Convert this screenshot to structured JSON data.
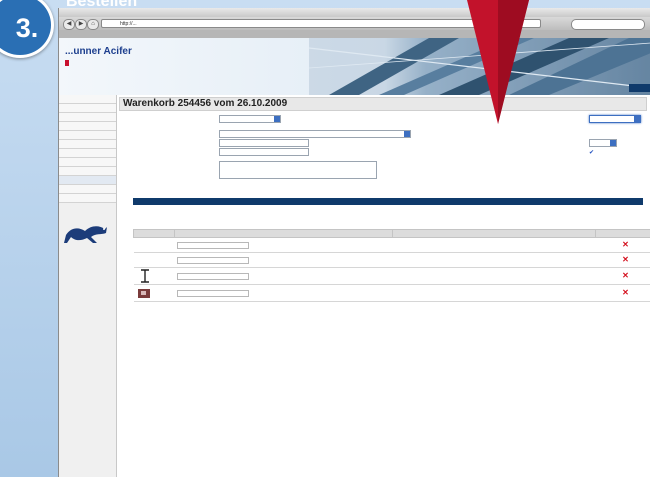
{
  "step": {
    "number": "3.",
    "title": "Bestellen"
  },
  "colors": {
    "brand_blue": "#2a6fb4",
    "nav_navy": "#0f3a6b",
    "accent_red": "#c8102e",
    "arrow_red": "#c2122b"
  },
  "browser": {
    "url": "http://..."
  },
  "site": {
    "logo_text": "...unner Acifer",
    "topnav": [
      "",
      "",
      "",
      "",
      ""
    ]
  },
  "sidebar": {
    "items": [
      "",
      "",
      "",
      "",
      "",
      "",
      "",
      "",
      "",
      "",
      "",
      ""
    ],
    "active_index": 9
  },
  "cart": {
    "title": "Warenkorb 254456 vom 26.10.2009",
    "fields": {},
    "buttons": [
      "",
      "",
      "",
      "",
      "",
      "",
      "",
      ""
    ],
    "note": {
      "text": "",
      "link": ""
    },
    "items_heading": "",
    "table": {
      "headers": [
        "",
        "",
        "",
        ""
      ],
      "rows": []
    },
    "footer_link": ""
  }
}
